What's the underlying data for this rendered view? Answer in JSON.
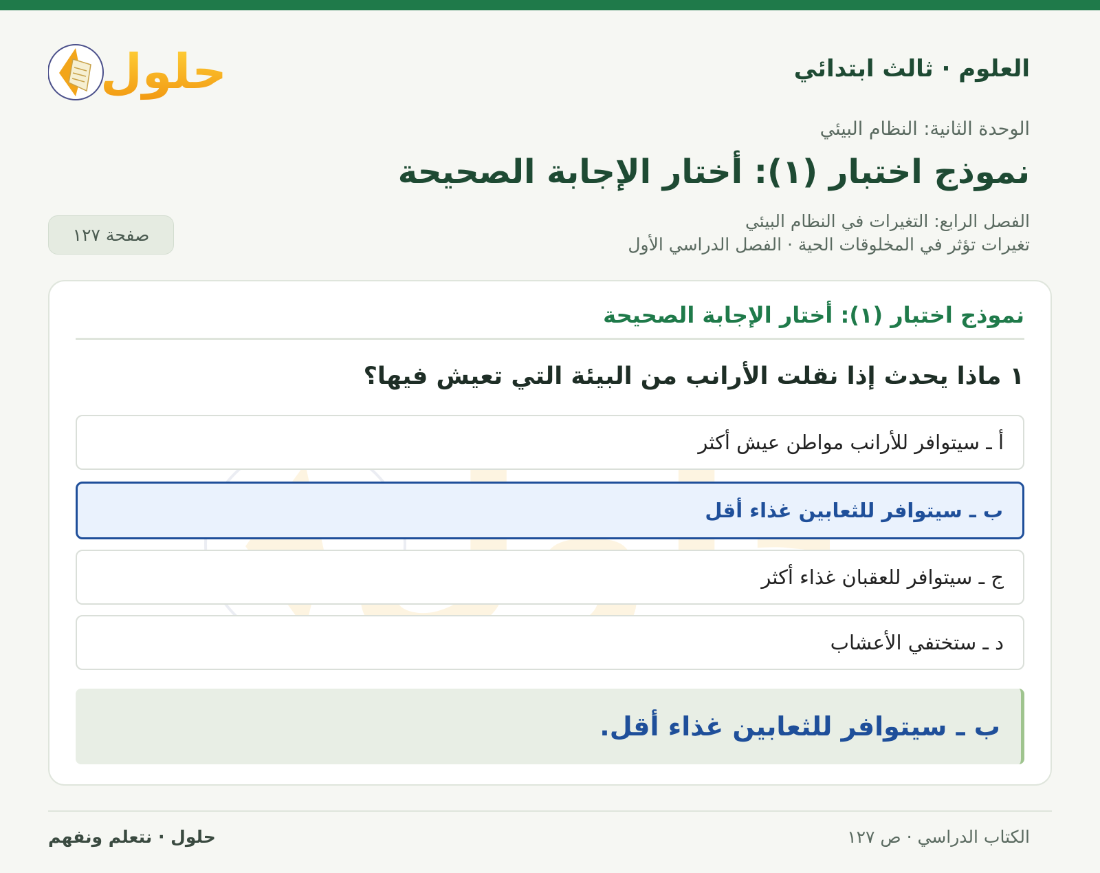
{
  "header": {
    "subject": "العلوم · ثالث ابتدائي",
    "logo_text": "حلول"
  },
  "unit": "الوحدة الثانية: النظام البيئي",
  "title": "نموذج اختبار (١): أختار الإجابة الصحيحة",
  "chapter": "الفصل الرابع: التغيرات في النظام البيئي",
  "lesson": "تغيرات تؤثر في المخلوقات الحية · الفصل الدراسي الأول",
  "page_label": "صفحة ١٢٧",
  "card": {
    "title": "نموذج اختبار (١): أختار الإجابة الصحيحة",
    "question": "١ ماذا يحدث إذا نقلت الأرانب من البيئة التي تعيش فيها؟",
    "options": [
      {
        "label": "أ ـ سيتوافر للأرانب مواطن عيش أكثر",
        "selected": false
      },
      {
        "label": "ب ـ سيتوافر للثعابين غذاء أقل",
        "selected": true
      },
      {
        "label": "ج ـ سيتوافر للعقبان غذاء أكثر",
        "selected": false
      },
      {
        "label": "د ـ ستختفي الأعشاب",
        "selected": false
      }
    ],
    "answer": "ب ـ سيتوافر للثعابين غذاء أقل."
  },
  "footer": {
    "left": "حلول · نتعلم ونفهم",
    "right": "الكتاب الدراسي · ص ١٢٧"
  },
  "colors": {
    "brand_green": "#1f7a4a",
    "selected_blue": "#1f4f9a",
    "logo_orange": "#f2a51a"
  }
}
